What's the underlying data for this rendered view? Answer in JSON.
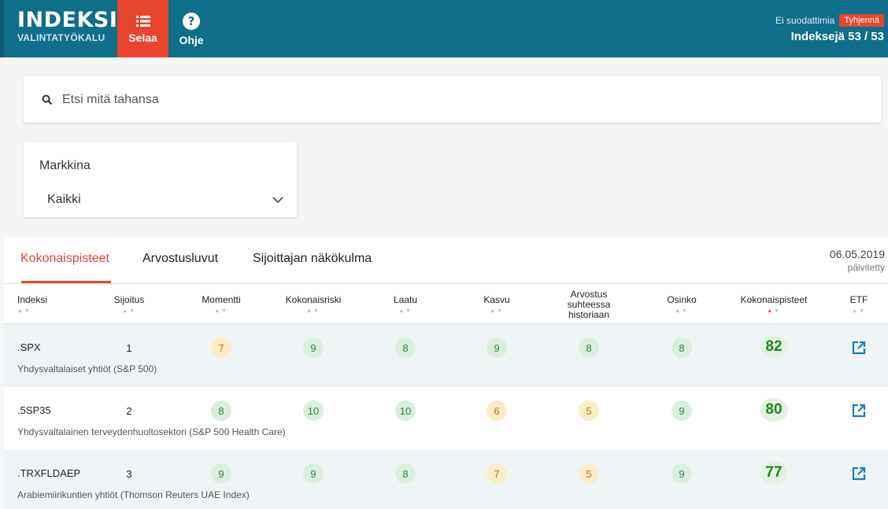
{
  "header": {
    "logo_line1": "INDEKSIN",
    "logo_line2": "VALINTATYÖKALU",
    "nav": [
      {
        "label": "Selaa",
        "icon": "list-icon",
        "active": true
      },
      {
        "label": "Ohje",
        "icon": "help-icon",
        "active": false
      }
    ],
    "filter_status": "Ei suodattimia",
    "clear_label": "Tyhjennä",
    "count_text": "Indeksejä 53 / 53"
  },
  "search": {
    "placeholder": "Etsi mitä tahansa",
    "icon": "search-icon"
  },
  "market": {
    "label": "Markkina",
    "selected": "Kaikki",
    "icon": "chevron-down-icon"
  },
  "tabs": [
    {
      "label": "Kokonaispisteet",
      "active": true
    },
    {
      "label": "Arvostusluvut",
      "active": false
    },
    {
      "label": "Sijoittajan näkökulma",
      "active": false
    }
  ],
  "updated": {
    "date": "06.05.2019",
    "label": "päivitetty"
  },
  "columns": [
    "Indeksi",
    "Sijoitus",
    "Momentti",
    "Kokonaisriski",
    "Laatu",
    "Kasvu",
    "Arvostus suhteessa historiaan",
    "Osinko",
    "Kokonaispisteet",
    "ETF"
  ],
  "sorted_column": "Kokonaispisteet",
  "rows": [
    {
      "code": ".SPX",
      "desc": "Yhdysvaltalaiset yhtiöt (S&P 500)",
      "rank": "1",
      "momentti": "7",
      "riski": "9",
      "laatu": "8",
      "kasvu": "9",
      "arvostus": "8",
      "osinko": "8",
      "total": "82"
    },
    {
      "code": ".5SP35",
      "desc": "Yhdysvaltalainen terveydenhuoltosektori (S&P 500 Health Care)",
      "rank": "2",
      "momentti": "8",
      "riski": "10",
      "laatu": "10",
      "kasvu": "6",
      "arvostus": "5",
      "osinko": "9",
      "total": "80"
    },
    {
      "code": ".TRXFLDAEP",
      "desc": "Arabiemiirikuntien yhtiöt (Thomson Reuters UAE Index)",
      "rank": "3",
      "momentti": "9",
      "riski": "9",
      "laatu": "8",
      "kasvu": "7",
      "arvostus": "5",
      "osinko": "9",
      "total": "77"
    }
  ],
  "colors": {
    "header_bg": "#0f6e8a",
    "accent": "#e8442e",
    "score_high_bg": "#dbeedd",
    "score_high_text": "#2e8b3a",
    "score_mid_bg": "#fbecc8",
    "score_mid_text": "#b07a10",
    "etf_icon": "#1a7fa8"
  }
}
